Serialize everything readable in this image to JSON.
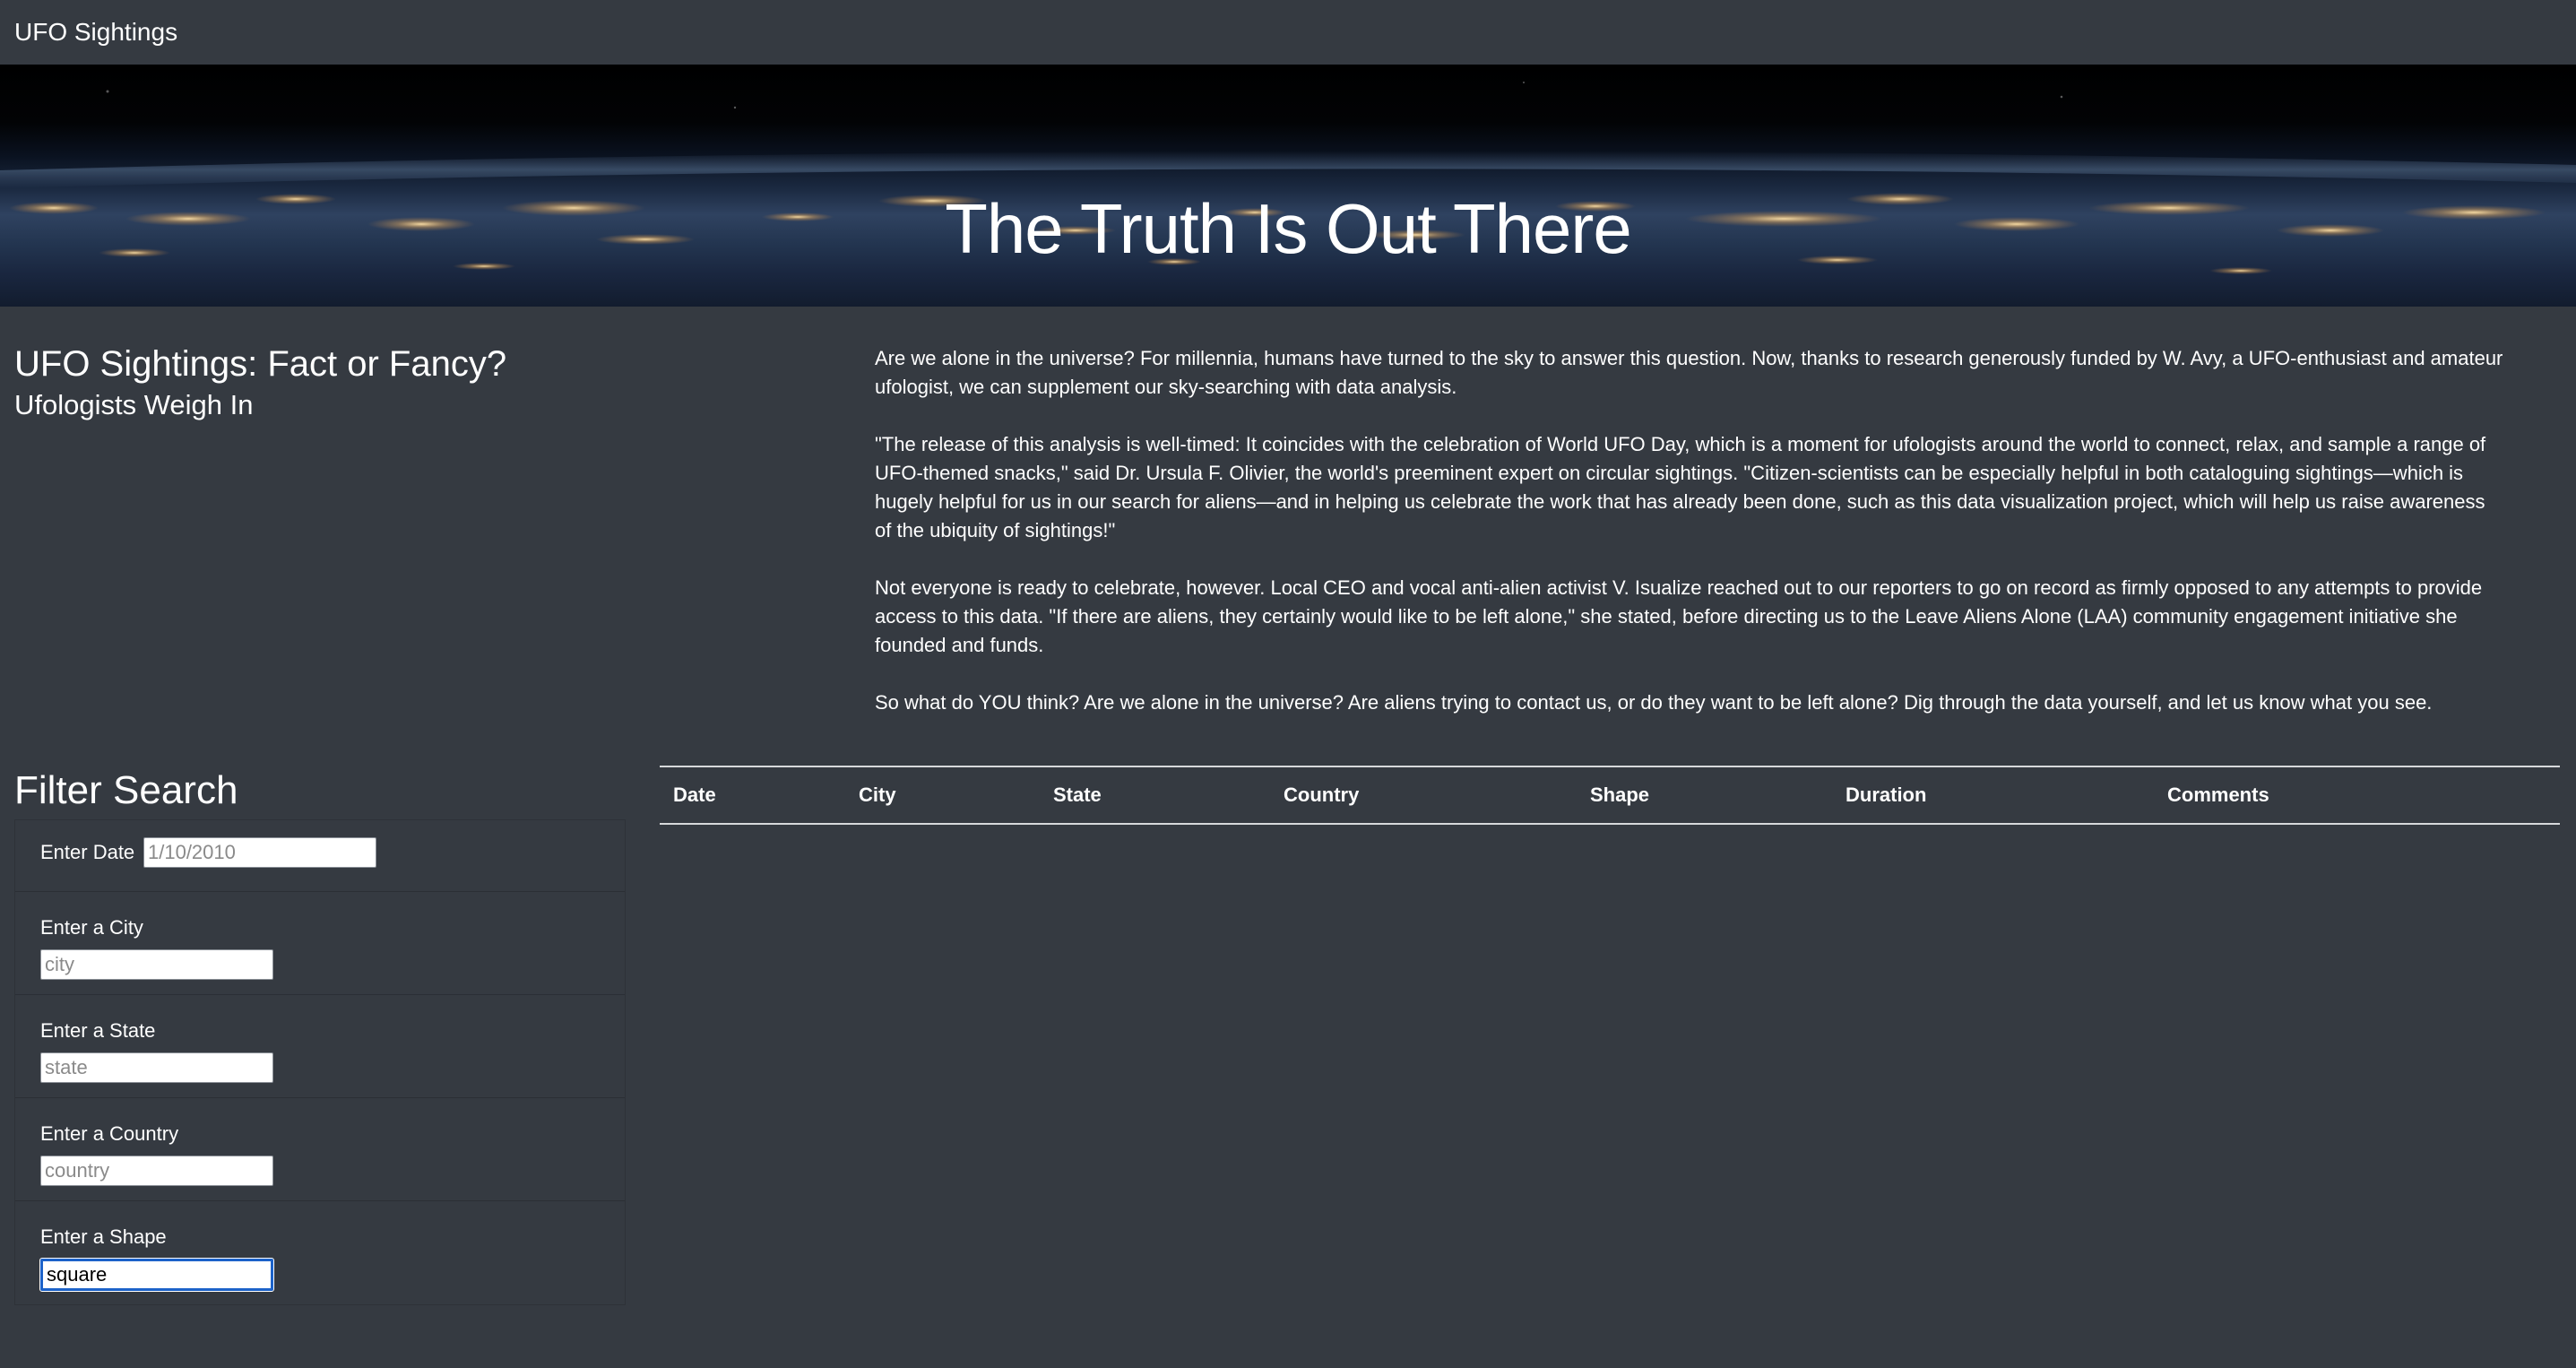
{
  "navbar": {
    "brand": "UFO Sightings"
  },
  "hero": {
    "title": "The Truth Is Out There"
  },
  "article": {
    "title": "UFO Sightings: Fact or Fancy?",
    "subtitle": "Ufologists Weigh In",
    "paragraphs": [
      "Are we alone in the universe? For millennia, humans have turned to the sky to answer this question. Now, thanks to research generously funded by W. Avy, a UFO-enthusiast and amateur ufologist, we can supplement our sky-searching with data analysis.",
      "\"The release of this analysis is well-timed: It coincides with the celebration of World UFO Day, which is a moment for ufologists around the world to connect, relax, and sample a range of UFO-themed snacks,\" said Dr. Ursula F. Olivier, the world's preeminent expert on circular sightings. \"Citizen-scientists can be especially helpful in both cataloguing sightings—which is hugely helpful for us in our search for aliens—and in helping us celebrate the work that has already been done, such as this data visualization project, which will help us raise awareness of the ubiquity of sightings!\"",
      "Not everyone is ready to celebrate, however. Local CEO and vocal anti-alien activist V. Isualize reached out to our reporters to go on record as firmly opposed to any attempts to provide access to this data. \"If there are aliens, they certainly would like to be left alone,\" she stated, before directing us to the Leave Aliens Alone (LAA) community engagement initiative she founded and funds.",
      "So what do YOU think? Are we alone in the universe? Are aliens trying to contact us, or do they want to be left alone? Dig through the data yourself, and let us know what you see."
    ]
  },
  "filters": {
    "title": "Filter Search",
    "date": {
      "label": "Enter Date",
      "placeholder": "1/10/2010",
      "value": ""
    },
    "city": {
      "label": "Enter a City",
      "placeholder": "city",
      "value": ""
    },
    "state": {
      "label": "Enter a State",
      "placeholder": "state",
      "value": ""
    },
    "country": {
      "label": "Enter a Country",
      "placeholder": "country",
      "value": ""
    },
    "shape": {
      "label": "Enter a Shape",
      "placeholder": "",
      "value": "square"
    }
  },
  "table": {
    "headers": [
      "Date",
      "City",
      "State",
      "Country",
      "Shape",
      "Duration",
      "Comments"
    ],
    "rows": []
  }
}
